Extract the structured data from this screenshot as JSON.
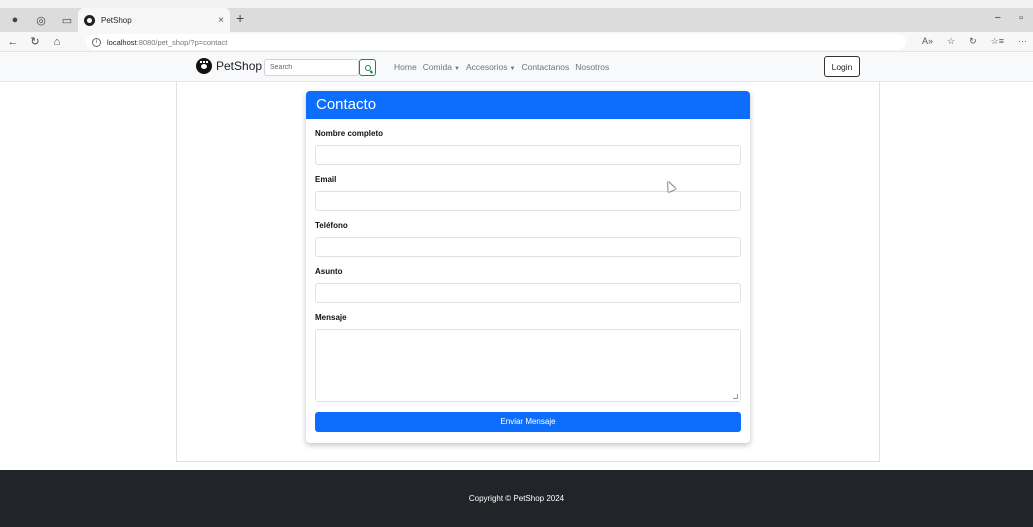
{
  "browser": {
    "tab_title": "PetShop",
    "tab_close": "×",
    "new_tab": "+",
    "url_host": "localhost",
    "url_rest": ":8080/pet_shop/?p=contact",
    "window_minimize": "−",
    "window_restore": "▫"
  },
  "navbar": {
    "brand": "PetShop",
    "search_placeholder": "Search",
    "menu": [
      {
        "label": "Home"
      },
      {
        "label": "Comida"
      },
      {
        "label": "Accesorios"
      },
      {
        "label": "Contactanos"
      },
      {
        "label": "Nosotros"
      }
    ],
    "login_label": "Login"
  },
  "contact": {
    "title": "Contacto",
    "fields": [
      {
        "label": "Nombre completo",
        "value": ""
      },
      {
        "label": "Email",
        "value": ""
      },
      {
        "label": "Teléfono",
        "value": ""
      },
      {
        "label": "Asunto",
        "value": ""
      },
      {
        "label": "Mensaje",
        "value": ""
      }
    ],
    "submit_label": "Enviar Mensaje"
  },
  "footer": {
    "copyright": "Copyright © PetShop 2024"
  },
  "colors": {
    "primary": "#0d6efd",
    "success": "#198754",
    "footer_bg": "#212529",
    "navbar_bg": "#f8f9fa"
  }
}
